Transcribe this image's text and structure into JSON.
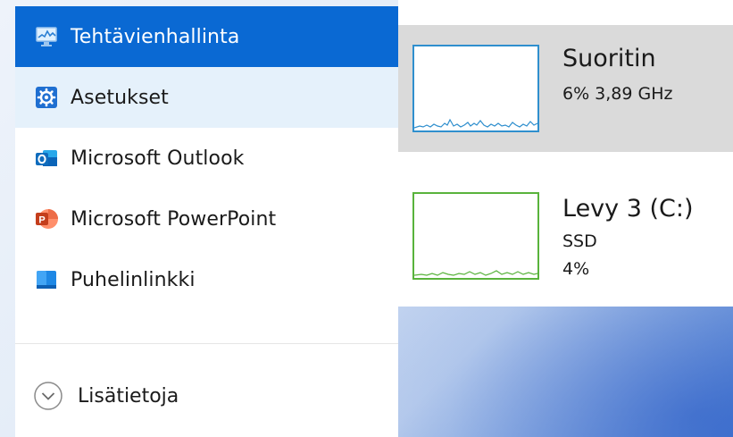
{
  "menu": {
    "items": [
      {
        "label": "Tehtävienhallinta",
        "icon": "task-manager-icon",
        "state": "selected"
      },
      {
        "label": "Asetukset",
        "icon": "settings-gear-icon",
        "state": "hover"
      },
      {
        "label": "Microsoft Outlook",
        "icon": "outlook-icon",
        "state": "normal"
      },
      {
        "label": "Microsoft PowerPoint",
        "icon": "powerpoint-icon",
        "state": "normal"
      },
      {
        "label": "Puhelinlinkki",
        "icon": "phone-link-icon",
        "state": "normal"
      }
    ],
    "more_label": "Lisätietoja"
  },
  "performance": {
    "cpu": {
      "title": "Suoritin",
      "detail": "6% 3,89 GHz"
    },
    "disk": {
      "title": "Levy 3 (C:)",
      "type": "SSD",
      "usage": "4%"
    }
  },
  "colors": {
    "selected": "#0a69d3",
    "hover": "#e5f1fb",
    "cpu_graph": "#2f8fce",
    "disk_graph": "#59b33c",
    "cpu_row_bg": "#dadada"
  }
}
